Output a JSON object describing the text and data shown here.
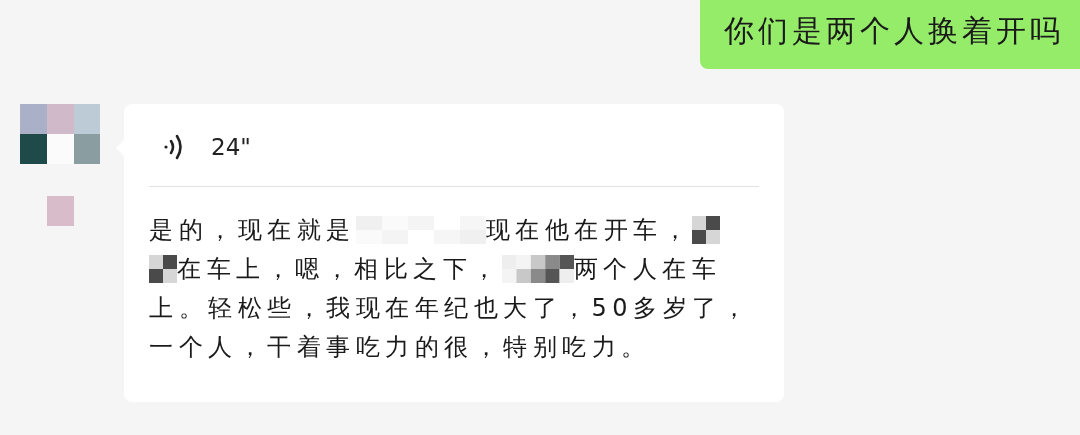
{
  "messages": [
    {
      "kind": "text",
      "outgoing": true,
      "text": "你们是两个人换着开吗"
    },
    {
      "kind": "voice",
      "outgoing": false,
      "duration": "24\"",
      "transcript": [
        [
          {
            "kind": "text",
            "text": "是的，现在就是"
          },
          {
            "kind": "mosaicwide"
          },
          {
            "kind": "text",
            "text": "现在他在开车，"
          },
          {
            "kind": "mosaicsmall"
          }
        ],
        [
          {
            "kind": "mosaicsmall"
          },
          {
            "kind": "text",
            "text": "在车上，嗯，相比之下，"
          },
          {
            "kind": "mosaicmedium"
          },
          {
            "kind": "text",
            "text": "两个人在车"
          }
        ],
        [
          {
            "kind": "text",
            "text": "上。轻松些，我现在年纪也大了，50多岁了，"
          }
        ],
        [
          {
            "kind": "text",
            "text": "一个人，干着事吃力的很，特别吃力。"
          }
        ]
      ]
    }
  ]
}
